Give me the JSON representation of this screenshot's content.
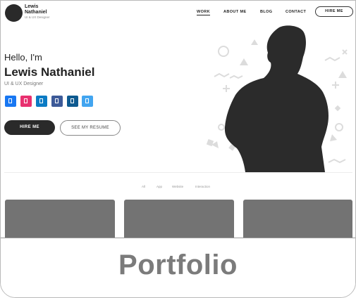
{
  "brand": {
    "name": "Lewis Nathaniel",
    "subtitle": "UI & UX Designer"
  },
  "nav": {
    "work": "WORK",
    "about": "ABOUT ME",
    "blog": "BLOG",
    "contact": "CONTACT",
    "hire": "HIRE ME"
  },
  "hero": {
    "greeting": "Hello, I'm",
    "name": "Lewis Nathaniel",
    "role": "UI & UX Designer",
    "hire_button": "HIRE ME",
    "resume_button": "SEE MY RESUME"
  },
  "social": [
    {
      "icon": "facebook-icon",
      "color": "#1877f2"
    },
    {
      "icon": "dribbble-icon",
      "color": "#e8306f"
    },
    {
      "icon": "behance-icon",
      "color": "#0b7bc4"
    },
    {
      "icon": "instagram-icon",
      "color": "#3d5a98"
    },
    {
      "icon": "linkedin-icon",
      "color": "#0e5a90"
    },
    {
      "icon": "twitter-icon",
      "color": "#42a5f0"
    }
  ],
  "filters": {
    "all": "All",
    "app": "App",
    "website": "Website",
    "interaction": "Interaction"
  },
  "banner": {
    "title": "Portfolio"
  },
  "colors": {
    "dark": "#2a2a2a",
    "card": "#737373",
    "banner_text": "#7b7b7b"
  }
}
